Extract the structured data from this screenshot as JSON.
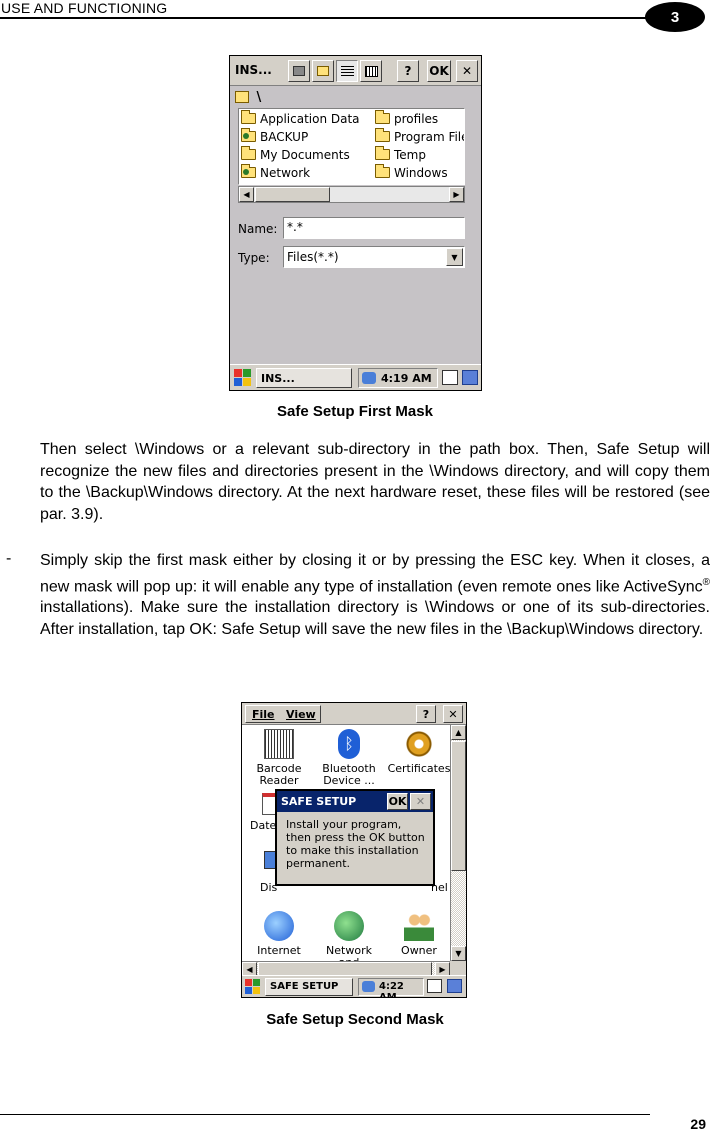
{
  "header": {
    "title": "USE AND FUNCTIONING",
    "chapter": "3"
  },
  "footer": {
    "page_number": "29"
  },
  "figure1": {
    "caption": "Safe Setup First Mask",
    "window_title": "INS...",
    "help_label": "?",
    "ok_label": "OK",
    "close_label": "✕",
    "path": "\\",
    "files": [
      "Application Data",
      "BACKUP",
      "My Documents",
      "Network",
      "profiles",
      "Program Files",
      "Temp",
      "Windows"
    ],
    "name_label": "Name:",
    "name_value": "*.*",
    "type_label": "Type:",
    "type_value": "Files(*.*)",
    "task_label": "INS...",
    "clock": "4:19 AM"
  },
  "paragraph1": "Then select \\Windows or a relevant sub-directory in the path box. Then, Safe Setup will recognize the new files and directories present in the \\Windows directory, and will copy them to the \\Backup\\Windows directory. At the next hardware reset, these files will be restored (see par. 3.9).",
  "paragraph2": {
    "bullet": "-",
    "part1": "Simply skip the first mask either by closing it or by pressing the ESC key. When it closes, a new mask will pop up: it will enable any type of installation (even remote ones like ActiveSync",
    "registered": "®",
    "part2": " installations). Make sure the installation directory is \\Windows or one of its sub-directories. After installation, tap OK: Safe Setup will save the new files in the \\Backup\\Windows directory."
  },
  "figure2": {
    "caption": "Safe Setup Second Mask",
    "menu": [
      "File",
      "View"
    ],
    "help_label": "?",
    "close_label": "✕",
    "icons": [
      {
        "line1": "Barcode",
        "line2": "Reader"
      },
      {
        "line1": "Bluetooth",
        "line2": "Device ..."
      },
      {
        "line1": "Certificates",
        "line2": ""
      },
      {
        "line1": "Internet",
        "line2": ""
      },
      {
        "line1": "Network and",
        "line2": ""
      },
      {
        "line1": "Owner",
        "line2": ""
      }
    ],
    "partial_left1": "Date",
    "partial_left2": "Dis",
    "partial_right": "nel",
    "dialog_title": "SAFE SETUP",
    "dialog_ok": "OK",
    "dialog_close": "✕",
    "dialog_message": "Install your program, then press the OK button to make this installation permanent.",
    "task_label": "SAFE SETUP",
    "clock": "4:22 AM"
  }
}
